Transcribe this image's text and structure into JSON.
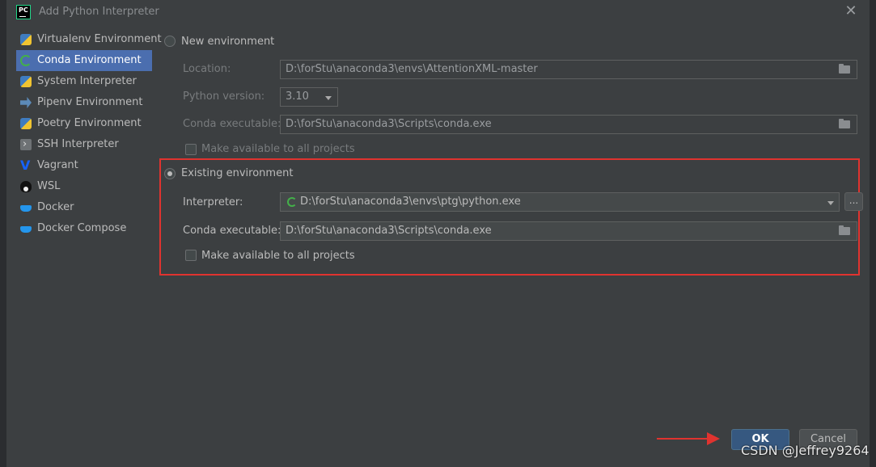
{
  "window": {
    "title": "Add Python Interpreter",
    "app_icon": "PC",
    "close": "✕"
  },
  "sidebar": {
    "items": [
      {
        "label": "Virtualenv Environment",
        "icon": "python-icon"
      },
      {
        "label": "Conda Environment",
        "icon": "conda-icon",
        "selected": true
      },
      {
        "label": "System Interpreter",
        "icon": "python-icon"
      },
      {
        "label": "Pipenv Environment",
        "icon": "pipenv-icon"
      },
      {
        "label": "Poetry Environment",
        "icon": "python-icon"
      },
      {
        "label": "SSH Interpreter",
        "icon": "ssh-icon"
      },
      {
        "label": "Vagrant",
        "icon": "vagrant-icon"
      },
      {
        "label": "WSL",
        "icon": "linux-icon"
      },
      {
        "label": "Docker",
        "icon": "docker-icon"
      },
      {
        "label": "Docker Compose",
        "icon": "docker-icon"
      }
    ]
  },
  "new_env": {
    "radio_label": "New environment",
    "location_label": "Location:",
    "location_value": "D:\\forStu\\anaconda3\\envs\\AttentionXML-master",
    "python_version_label": "Python version:",
    "python_version_value": "3.10",
    "conda_exec_label": "Conda executable:",
    "conda_exec_value": "D:\\forStu\\anaconda3\\Scripts\\conda.exe",
    "make_available_label": "Make available to all projects"
  },
  "existing_env": {
    "radio_label": "Existing environment",
    "interpreter_label": "Interpreter:",
    "interpreter_value": "D:\\forStu\\anaconda3\\envs\\ptg\\python.exe",
    "browse_label": "...",
    "conda_exec_label": "Conda executable:",
    "conda_exec_value": "D:\\forStu\\anaconda3\\Scripts\\conda.exe",
    "make_available_label": "Make available to all projects"
  },
  "buttons": {
    "ok": "OK",
    "cancel": "Cancel"
  },
  "watermark": "CSDN @Jeffrey9264",
  "colors": {
    "highlight": "#e0332f",
    "selection": "#4b6eaf",
    "ok_button": "#365880"
  }
}
